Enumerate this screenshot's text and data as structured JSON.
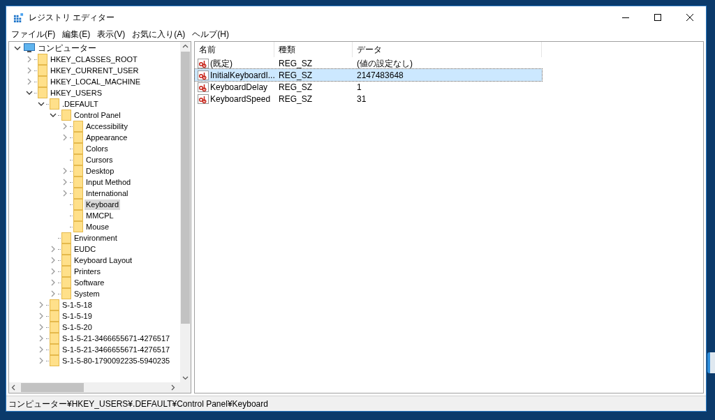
{
  "window": {
    "title": "レジストリ エディター"
  },
  "menu": [
    "ファイル(F)",
    "編集(E)",
    "表示(V)",
    "お気に入り(A)",
    "ヘルプ(H)"
  ],
  "tree": [
    {
      "label": "コンピューター",
      "kind": "computer",
      "expandable": true,
      "expanded": true,
      "selected": false,
      "children": [
        {
          "label": "HKEY_CLASSES_ROOT",
          "kind": "folder",
          "expandable": true,
          "expanded": false,
          "selected": false
        },
        {
          "label": "HKEY_CURRENT_USER",
          "kind": "folder",
          "expandable": true,
          "expanded": false,
          "selected": false
        },
        {
          "label": "HKEY_LOCAL_MACHINE",
          "kind": "folder",
          "expandable": true,
          "expanded": false,
          "selected": false
        },
        {
          "label": "HKEY_USERS",
          "kind": "folder",
          "expandable": true,
          "expanded": true,
          "selected": false,
          "children": [
            {
              "label": ".DEFAULT",
              "kind": "folder",
              "expandable": true,
              "expanded": true,
              "selected": false,
              "children": [
                {
                  "label": "Control Panel",
                  "kind": "folder",
                  "expandable": true,
                  "expanded": true,
                  "selected": false,
                  "children": [
                    {
                      "label": "Accessibility",
                      "kind": "folder",
                      "expandable": true,
                      "expanded": false,
                      "selected": false
                    },
                    {
                      "label": "Appearance",
                      "kind": "folder",
                      "expandable": true,
                      "expanded": false,
                      "selected": false
                    },
                    {
                      "label": "Colors",
                      "kind": "folder",
                      "expandable": false,
                      "selected": false
                    },
                    {
                      "label": "Cursors",
                      "kind": "folder",
                      "expandable": false,
                      "selected": false
                    },
                    {
                      "label": "Desktop",
                      "kind": "folder",
                      "expandable": true,
                      "expanded": false,
                      "selected": false
                    },
                    {
                      "label": "Input Method",
                      "kind": "folder",
                      "expandable": true,
                      "expanded": false,
                      "selected": false
                    },
                    {
                      "label": "International",
                      "kind": "folder",
                      "expandable": true,
                      "expanded": false,
                      "selected": false
                    },
                    {
                      "label": "Keyboard",
                      "kind": "folder",
                      "expandable": false,
                      "selected": true
                    },
                    {
                      "label": "MMCPL",
                      "kind": "folder",
                      "expandable": false,
                      "selected": false
                    },
                    {
                      "label": "Mouse",
                      "kind": "folder",
                      "expandable": false,
                      "selected": false
                    }
                  ]
                },
                {
                  "label": "Environment",
                  "kind": "folder",
                  "expandable": false,
                  "selected": false
                },
                {
                  "label": "EUDC",
                  "kind": "folder",
                  "expandable": true,
                  "expanded": false,
                  "selected": false
                },
                {
                  "label": "Keyboard Layout",
                  "kind": "folder",
                  "expandable": true,
                  "expanded": false,
                  "selected": false
                },
                {
                  "label": "Printers",
                  "kind": "folder",
                  "expandable": true,
                  "expanded": false,
                  "selected": false
                },
                {
                  "label": "Software",
                  "kind": "folder",
                  "expandable": true,
                  "expanded": false,
                  "selected": false
                },
                {
                  "label": "System",
                  "kind": "folder",
                  "expandable": true,
                  "expanded": false,
                  "selected": false
                }
              ]
            },
            {
              "label": "S-1-5-18",
              "kind": "folder",
              "expandable": true,
              "expanded": false,
              "selected": false
            },
            {
              "label": "S-1-5-19",
              "kind": "folder",
              "expandable": true,
              "expanded": false,
              "selected": false
            },
            {
              "label": "S-1-5-20",
              "kind": "folder",
              "expandable": true,
              "expanded": false,
              "selected": false
            },
            {
              "label": "S-1-5-21-3466655671-4276517",
              "kind": "folder",
              "expandable": true,
              "expanded": false,
              "selected": false
            },
            {
              "label": "S-1-5-21-3466655671-4276517",
              "kind": "folder",
              "expandable": true,
              "expanded": false,
              "selected": false
            },
            {
              "label": "S-1-5-80-1790092235-5940235",
              "kind": "folder",
              "expandable": true,
              "expanded": false,
              "selected": false
            }
          ]
        }
      ]
    }
  ],
  "table": {
    "columns": [
      "名前",
      "種類",
      "データ"
    ],
    "rows": [
      {
        "name": "(既定)",
        "type": "REG_SZ",
        "data": "(値の設定なし)",
        "selected": false
      },
      {
        "name": "InitialKeyboardI...",
        "type": "REG_SZ",
        "data": "2147483648",
        "selected": true
      },
      {
        "name": "KeyboardDelay",
        "type": "REG_SZ",
        "data": "1",
        "selected": false
      },
      {
        "name": "KeyboardSpeed",
        "type": "REG_SZ",
        "data": "31",
        "selected": false
      }
    ]
  },
  "status_bar": "コンピューター¥HKEY_USERS¥.DEFAULT¥Control Panel¥Keyboard"
}
